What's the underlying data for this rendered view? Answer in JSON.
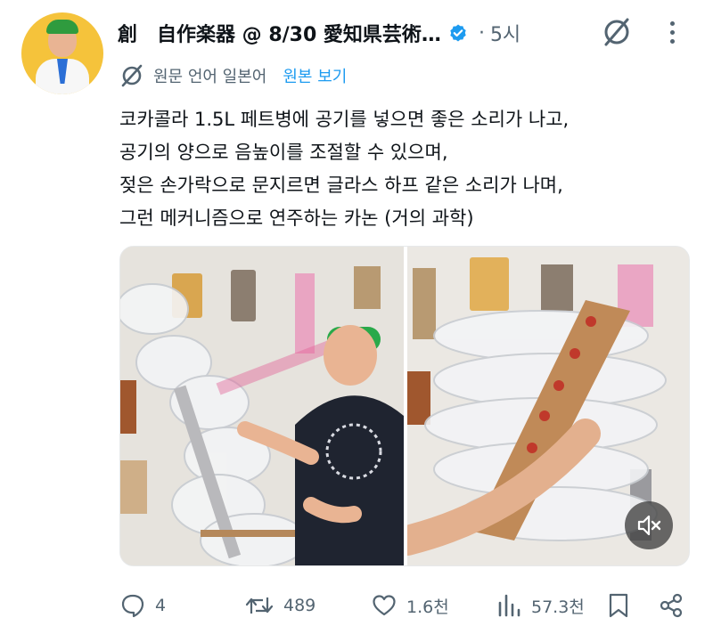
{
  "tweet": {
    "display_name": "創　自作楽器 @ 8/30 愛知県芸術…",
    "dot": "·",
    "time": "5시",
    "translation": {
      "label": "원문 언어 일본어",
      "view_original": "원본 보기"
    },
    "text_lines": [
      "코카콜라 1.5L 페트병에 공기를 넣으면 좋은 소리가 나고,",
      "공기의 양으로 음높이를 조절할 수 있으며,",
      "젖은 손가락으로 문지르면 글라스 하프 같은 소리가 나며,",
      "그런 메커니즘으로 연주하는 카논 (거의 과학)"
    ]
  },
  "actions": {
    "reply_count": "4",
    "retweet_count": "489",
    "like_count": "1.6천",
    "view_count": "57.3천"
  },
  "colors": {
    "text": "#0f1419",
    "secondary": "#536471",
    "accent": "#1d9bf0",
    "verified": "#1d9bf0"
  },
  "icons": {
    "verified": "verified-badge-icon",
    "grok": "grok-icon",
    "more": "more-vertical-icon",
    "translate": "translate-icon",
    "reply": "reply-icon",
    "retweet": "retweet-icon",
    "like": "heart-icon",
    "views": "views-icon",
    "bookmark": "bookmark-icon",
    "share": "share-icon",
    "mute": "mute-icon"
  }
}
